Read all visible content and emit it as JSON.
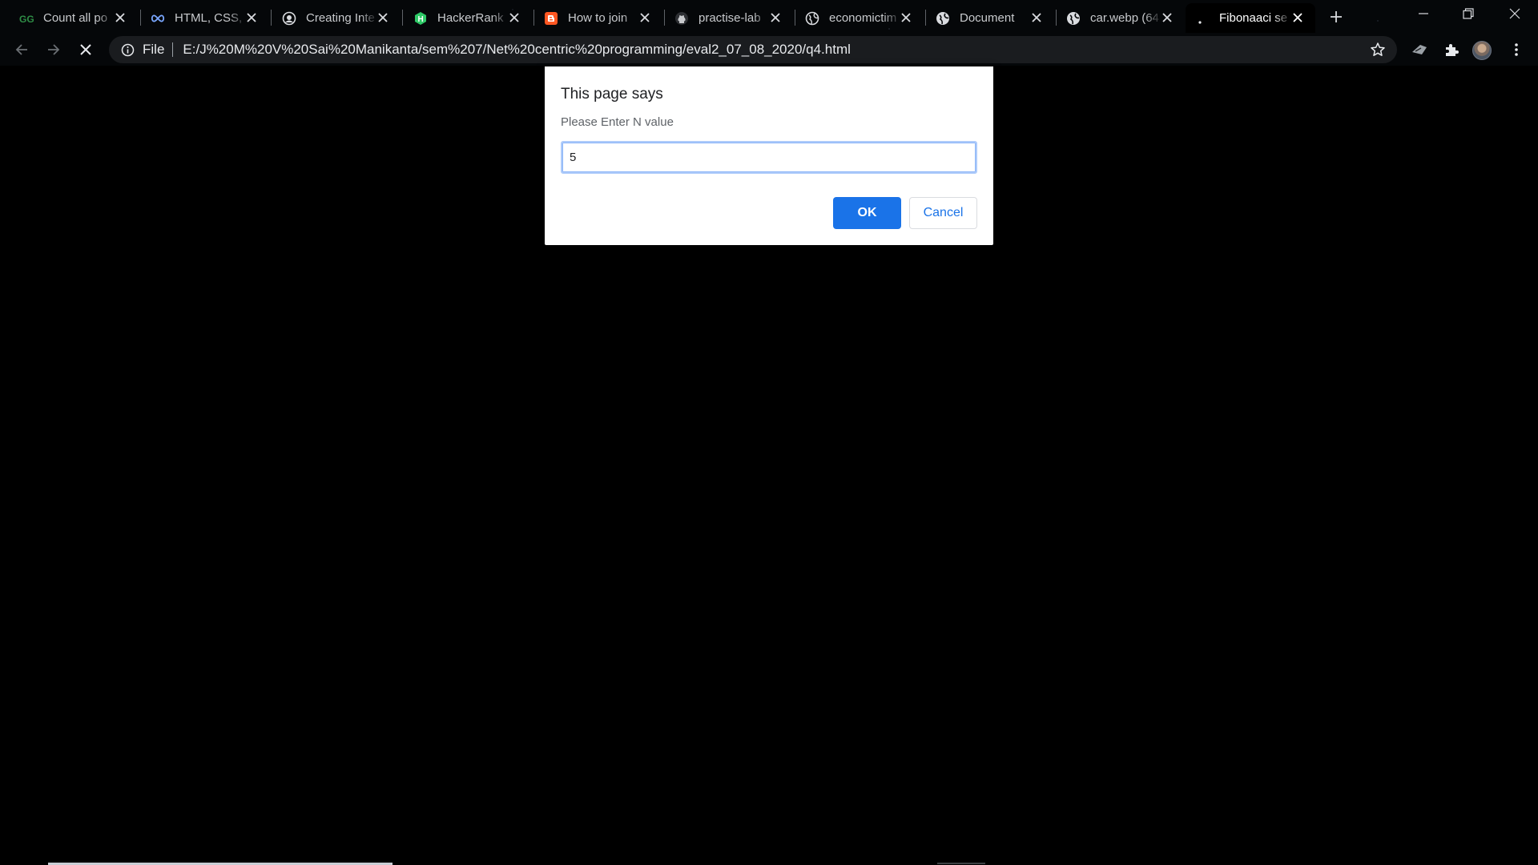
{
  "browser": {
    "tabs": [
      {
        "title": "Count all po",
        "favicon": "gfg-icon",
        "color": "#2f8d46"
      },
      {
        "title": "HTML, CSS, a",
        "favicon": "infinity-icon",
        "color": "#7aa7ff"
      },
      {
        "title": "Creating Inte",
        "favicon": "globe-icon",
        "color": "#dadce0"
      },
      {
        "title": "HackerRank",
        "favicon": "hackerrank-icon",
        "color": "#2ec866"
      },
      {
        "title": "How to join",
        "favicon": "blogger-icon",
        "color": "#ff5722"
      },
      {
        "title": "practise-lab",
        "favicon": "github-icon",
        "color": "#c8cacd"
      },
      {
        "title": "economictim",
        "favicon": "globe-icon",
        "color": "#dadce0"
      },
      {
        "title": "Document",
        "favicon": "globe-icon",
        "color": "#dadce0"
      },
      {
        "title": "car.webp (64",
        "favicon": "globe-icon",
        "color": "#dadce0"
      },
      {
        "title": "Fibonaaci se",
        "favicon": "loading-icon",
        "color": "#ffffff",
        "active": true
      }
    ],
    "address_bar": {
      "scheme_label": "File",
      "url": "E:/J%20M%20V%20Sai%20Manikanta/sem%207/Net%20centric%20programming/eval2_07_08_2020/q4.html"
    }
  },
  "dialog": {
    "title": "This page says",
    "message": "Please Enter N value",
    "input_value": "5",
    "ok_label": "OK",
    "cancel_label": "Cancel",
    "accent_color": "#1a73e8"
  }
}
